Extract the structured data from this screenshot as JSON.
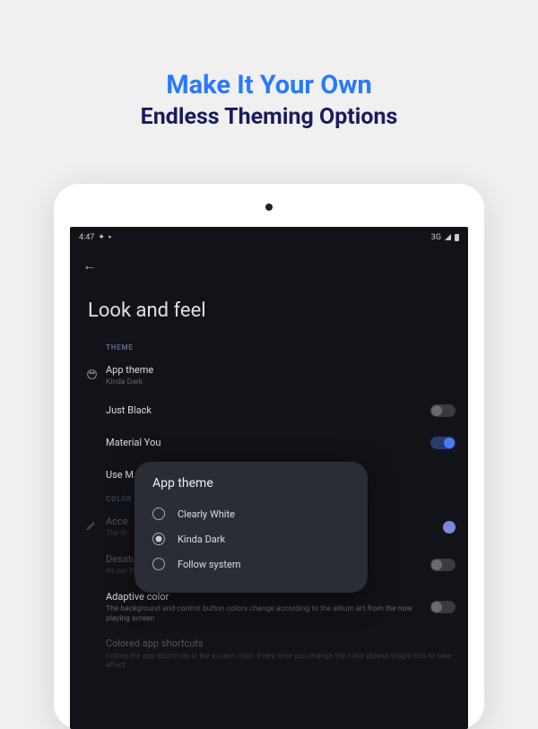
{
  "hero": {
    "title": "Make It Your Own",
    "subtitle": "Endless Theming Options"
  },
  "statusbar": {
    "time": "4:47",
    "network": "3G"
  },
  "page": {
    "title": "Look and feel"
  },
  "sections": {
    "theme_label": "THEME",
    "color_label": "COLOR"
  },
  "settings": {
    "app_theme": {
      "title": "App theme",
      "sub": "Kinda Dark"
    },
    "just_black": {
      "title": "Just Black"
    },
    "material_you": {
      "title": "Material You"
    },
    "use_m": {
      "title": "Use M"
    },
    "accent": {
      "title": "Acce",
      "sub": "The th"
    },
    "desaturated": {
      "title": "Desaturated",
      "sub": "As per Material Design guide lines in dark mode colors should be desaturated"
    },
    "adaptive": {
      "title": "Adaptive color",
      "sub": "The background and control button colors change according to the album art from the now playing screen"
    },
    "shortcuts": {
      "title": "Colored app shortcuts",
      "sub": "Colors the app shortcuts in the accent color. Every time you change the color please toggle this to take effect"
    }
  },
  "dialog": {
    "title": "App theme",
    "options": [
      {
        "label": "Clearly White",
        "selected": false
      },
      {
        "label": "Kinda Dark",
        "selected": true
      },
      {
        "label": "Follow system",
        "selected": false
      }
    ]
  }
}
